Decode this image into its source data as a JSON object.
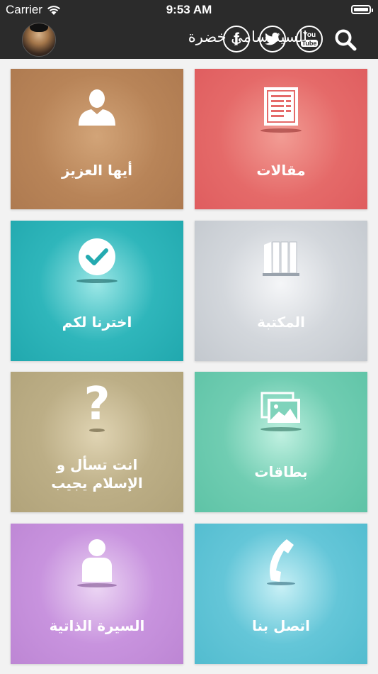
{
  "status": {
    "carrier": "Carrier",
    "time": "9:53 AM"
  },
  "header": {
    "title": "السيد سامي خضرة",
    "youtube_top": "You",
    "youtube_bottom": "Tube",
    "facebook_letter": "f"
  },
  "tiles": [
    {
      "label": "مقالات",
      "icon": "article-icon",
      "color": "#e8686a"
    },
    {
      "label": "أيها العزيز",
      "icon": "person-icon",
      "color": "#b88458"
    },
    {
      "label": "المكتبة",
      "icon": "books-icon",
      "color": "#c6cbd1"
    },
    {
      "label": "اخترنا لكم",
      "icon": "checkmark-icon",
      "color": "#27b0b6"
    },
    {
      "label": "بطاقات",
      "icon": "gallery-icon",
      "color": "#6fcbb1"
    },
    {
      "label_line1": "انت تسأل و",
      "label_line2": "الإسلام يجيب",
      "icon": "question-icon",
      "color": "#b8aa82"
    },
    {
      "label": "اتصل بنا",
      "icon": "phone-icon",
      "color": "#61c4d6"
    },
    {
      "label": "السيرة الذاتية",
      "icon": "profile-icon",
      "color": "#c48fdc"
    }
  ]
}
